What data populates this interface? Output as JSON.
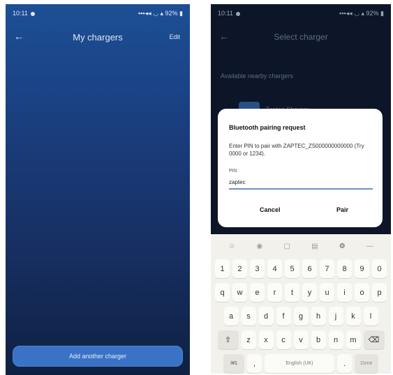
{
  "left": {
    "status_time": "10:11",
    "status_battery": "92%",
    "title": "My chargers",
    "edit_label": "Edit",
    "add_button": "Add another charger"
  },
  "right": {
    "status_time": "10:11",
    "status_battery": "92%",
    "title": "Select charger",
    "section": "Available nearby chargers",
    "charger_name": "Zaptec Charger",
    "dialog": {
      "title": "Bluetooth pairing request",
      "message": "Enter PIN to pair with ZAPTEC_ZS000000000000 (Try 0000 or 1234).",
      "pin_label": "PIN",
      "pin_value": "zaptec",
      "cancel": "Cancel",
      "pair": "Pair"
    },
    "keyboard": {
      "row1": [
        "1",
        "2",
        "3",
        "4",
        "5",
        "6",
        "7",
        "8",
        "9",
        "0"
      ],
      "row2": [
        "q",
        "w",
        "e",
        "r",
        "t",
        "y",
        "u",
        "i",
        "o",
        "p"
      ],
      "row3": [
        "a",
        "s",
        "d",
        "f",
        "g",
        "h",
        "j",
        "k",
        "l"
      ],
      "row4_letters": [
        "z",
        "x",
        "c",
        "v",
        "b",
        "n",
        "m"
      ],
      "shift_icon": "shift-icon",
      "backspace_icon": "backspace-icon",
      "symbols": "!#1",
      "comma": ",",
      "space": "English (UK)",
      "period": ".",
      "done": "Done"
    }
  }
}
